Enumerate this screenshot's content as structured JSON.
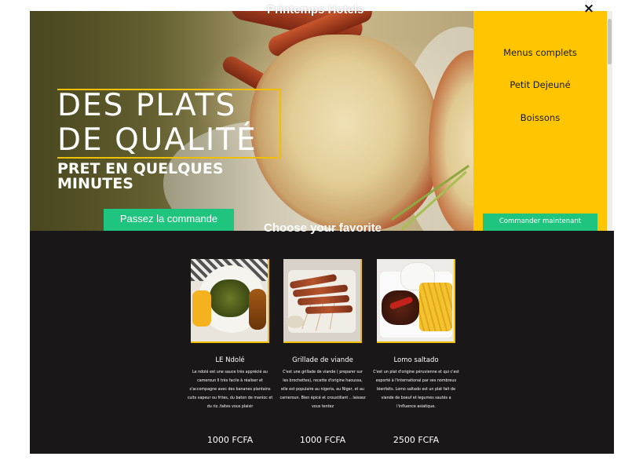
{
  "site": {
    "title": "Printemps Hotels"
  },
  "hero": {
    "title": "DES PLATS\nDE QUALITÉ",
    "subtitle": "PRET EN QUELQUES MINUTES",
    "cta_label": "Passez la commande"
  },
  "side_menu": {
    "items": [
      {
        "label": "Menus complets"
      },
      {
        "label": "Petit Dejeuné"
      },
      {
        "label": "Boissons"
      }
    ],
    "order_label": "Commander maintenant",
    "close_icon": "close-icon"
  },
  "menu_section": {
    "heading": "Choose your favorite",
    "dishes": [
      {
        "name": "LE Ndolé",
        "description": "Le ndolé est une sauce très apprécié au cameroun Il très facile à réaliser et s'accompagne avec des bananes plantains cuits vapeur ou frites, du baton de manioc et du riz..faites vous plaisir",
        "price": "1000 FCFA"
      },
      {
        "name": "Grillade de viande",
        "description": "C'est une grillade de viande ( preparer sur les brochettes), recette d'origine haoussa, elle est populaire au nigeria, au Niger, et au cameroun. Bien épicé et croustillant .. laissez vous tentez",
        "price": "1000 FCFA"
      },
      {
        "name": "Lomo saltado",
        "description": "C'est un plat d'origine péruvienne et qui c'est exporté à l'international par ses nombreux bienfaits. Lomo saltado est un plat fait de viande de boeuf et legumes sautés a l'influence asiatique.",
        "price": "2500 FCFA"
      }
    ]
  },
  "colors": {
    "accent_yellow": "#ffc600",
    "cta_green": "#1fc47e",
    "section_dark": "#1a1718",
    "gold_border": "#f0c000"
  }
}
